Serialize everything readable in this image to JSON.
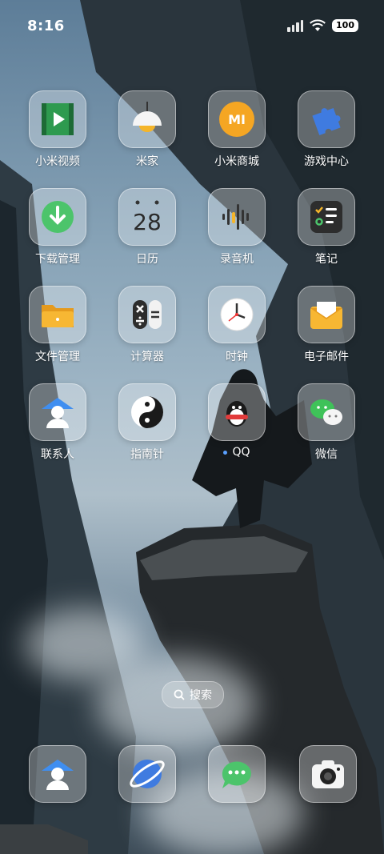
{
  "status_bar": {
    "time": "8:16",
    "battery": "100"
  },
  "apps": [
    {
      "label": "小米视频",
      "icon": "video-icon"
    },
    {
      "label": "米家",
      "icon": "lamp-icon"
    },
    {
      "label": "小米商城",
      "icon": "mi-store-icon"
    },
    {
      "label": "游戏中心",
      "icon": "puzzle-icon"
    },
    {
      "label": "下载管理",
      "icon": "download-icon"
    },
    {
      "label": "日历",
      "icon": "calendar-icon",
      "date": "28"
    },
    {
      "label": "录音机",
      "icon": "recorder-icon"
    },
    {
      "label": "笔记",
      "icon": "notes-icon"
    },
    {
      "label": "文件管理",
      "icon": "folder-icon"
    },
    {
      "label": "计算器",
      "icon": "calculator-icon"
    },
    {
      "label": "时钟",
      "icon": "clock-icon"
    },
    {
      "label": "电子邮件",
      "icon": "mail-icon"
    },
    {
      "label": "联系人",
      "icon": "contacts-icon"
    },
    {
      "label": "指南针",
      "icon": "compass-icon"
    },
    {
      "label": "QQ",
      "icon": "qq-icon"
    },
    {
      "label": "微信",
      "icon": "wechat-icon"
    }
  ],
  "search": {
    "label": "搜索"
  },
  "dock": [
    {
      "icon": "phone-contacts-icon"
    },
    {
      "icon": "browser-icon"
    },
    {
      "icon": "messages-icon"
    },
    {
      "icon": "camera-icon"
    }
  ],
  "colors": {
    "accent_dot": "#5aa0ff"
  }
}
